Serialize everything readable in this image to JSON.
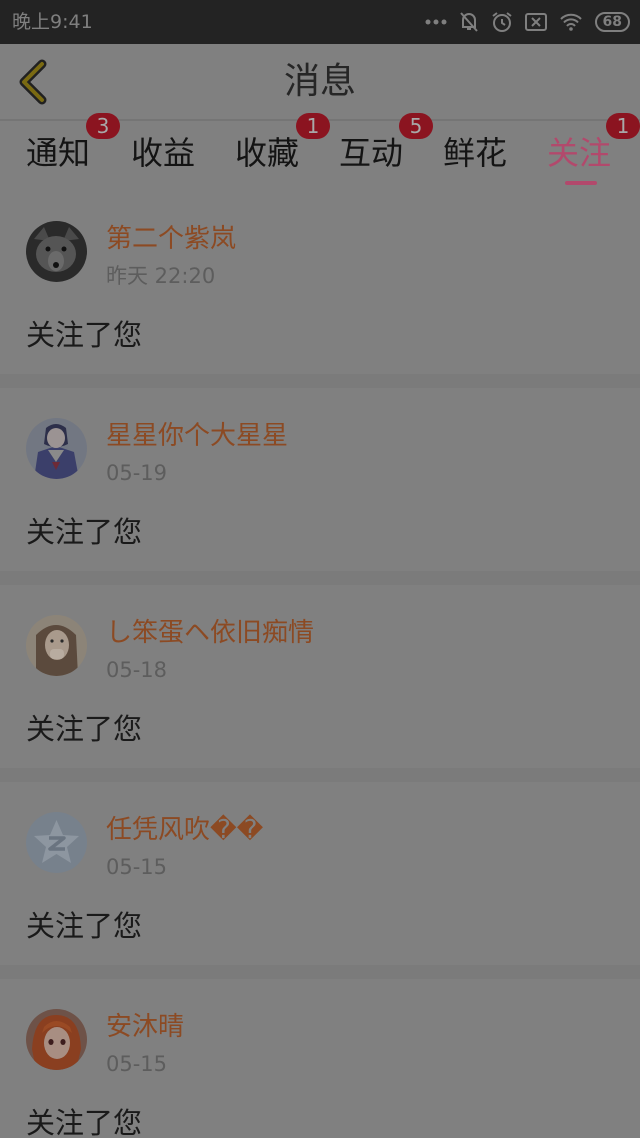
{
  "status_bar": {
    "time": "晚上9:41",
    "battery": "68",
    "icons": [
      "signal-dots-icon",
      "bell-off-icon",
      "alarm-icon",
      "sim-off-icon",
      "wifi-icon",
      "battery-icon"
    ]
  },
  "header": {
    "title": "消息",
    "back_icon": "chevron-left-icon"
  },
  "tabs": [
    {
      "label": "通知",
      "badge": "3"
    },
    {
      "label": "收益",
      "badge": ""
    },
    {
      "label": "收藏",
      "badge": "1"
    },
    {
      "label": "互动",
      "badge": "5"
    },
    {
      "label": "鲜花",
      "badge": ""
    },
    {
      "label": "关注",
      "badge": "1",
      "active": true
    }
  ],
  "messages": [
    {
      "username": "第二个紫岚",
      "time": "昨天 22:20",
      "text": "关注了您",
      "avatar": "wolf-avatar"
    },
    {
      "username": "星星你个大星星",
      "time": "05-19",
      "text": "关注了您",
      "avatar": "anime-sailor-avatar"
    },
    {
      "username": "し笨蛋ヘ依旧痴情",
      "time": "05-18",
      "text": "关注了您",
      "avatar": "girl-photo-avatar"
    },
    {
      "username": "任凭风吹��",
      "time": "05-15",
      "text": "关注了您",
      "avatar": "default-z-avatar"
    },
    {
      "username": "安沐晴",
      "time": "05-15",
      "text": "关注了您",
      "avatar": "anime-redhair-avatar"
    }
  ],
  "colors": {
    "accent": "#b2496c",
    "badge": "#8b1420",
    "username": "#8c4a23"
  }
}
